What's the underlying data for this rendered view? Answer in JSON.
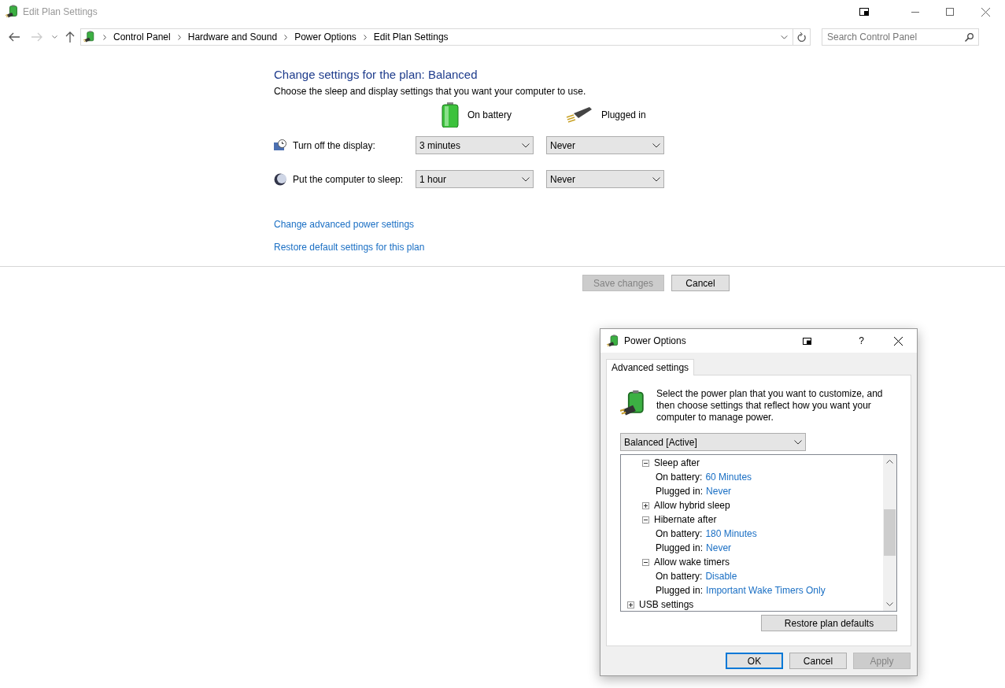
{
  "window": {
    "title": "Edit Plan Settings"
  },
  "address_bar": {
    "breadcrumbs": [
      "Control Panel",
      "Hardware and Sound",
      "Power Options",
      "Edit Plan Settings"
    ]
  },
  "search": {
    "placeholder": "Search Control Panel"
  },
  "heading": "Change settings for the plan: Balanced",
  "subtitle": "Choose the sleep and display settings that you want your computer to use.",
  "columns": [
    {
      "kind": "battery",
      "label": "On battery"
    },
    {
      "kind": "plug",
      "label": "Plugged in"
    }
  ],
  "settings": [
    {
      "kind": "display",
      "label": "Turn off the display:",
      "values": [
        "3 minutes",
        "Never"
      ]
    },
    {
      "kind": "sleep",
      "label": "Put the computer to sleep:",
      "values": [
        "1 hour",
        "Never"
      ]
    }
  ],
  "links": [
    "Change advanced power settings",
    "Restore default settings for this plan"
  ],
  "buttons": [
    {
      "label": "Save changes",
      "disabled": true
    },
    {
      "label": "Cancel",
      "disabled": false
    }
  ],
  "dialog": {
    "title": "Power Options",
    "help": "?",
    "tabs": [
      {
        "label": "Advanced settings",
        "selected": true
      }
    ],
    "description": "Select the power plan that you want to customize, and then choose settings that reflect how you want your computer to manage power.",
    "plan": "Balanced [Active]",
    "tree": [
      {
        "kind": "group",
        "children": [
          {
            "kind": "group",
            "label": "Sleep after",
            "expanded": true,
            "children": [
              {
                "kind": "setting",
                "label": "On battery:",
                "value": "60 Minutes"
              },
              {
                "kind": "setting",
                "label": "Plugged in:",
                "value": "Never"
              }
            ]
          },
          {
            "kind": "group",
            "label": "Allow hybrid sleep",
            "expanded": false
          },
          {
            "kind": "group",
            "label": "Hibernate after",
            "expanded": true,
            "children": [
              {
                "kind": "setting",
                "label": "On battery:",
                "value": "180 Minutes"
              },
              {
                "kind": "setting",
                "label": "Plugged in:",
                "value": "Never"
              }
            ]
          },
          {
            "kind": "group",
            "label": "Allow wake timers",
            "expanded": true,
            "children": [
              {
                "kind": "setting",
                "label": "On battery:",
                "value": "Disable"
              },
              {
                "kind": "setting",
                "label": "Plugged in:",
                "value": "Important Wake Timers Only"
              }
            ]
          }
        ]
      },
      {
        "kind": "group",
        "label": "USB settings",
        "expanded": false
      }
    ],
    "restore_button": "Restore plan defaults",
    "buttons": [
      {
        "label": "OK",
        "default": true,
        "disabled": false
      },
      {
        "label": "Cancel",
        "default": false,
        "disabled": false
      },
      {
        "label": "Apply",
        "default": false,
        "disabled": true
      }
    ]
  }
}
